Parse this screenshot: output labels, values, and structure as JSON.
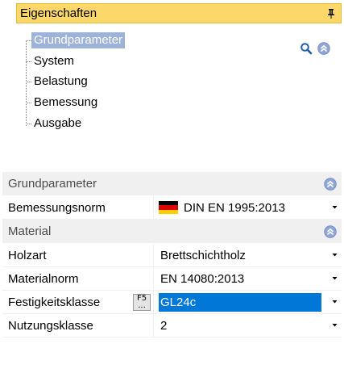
{
  "panel": {
    "title": "Eigenschaften",
    "pin_icon": "pin-icon"
  },
  "tree": {
    "items": [
      {
        "label": "Grundparameter",
        "selected": true
      },
      {
        "label": "System",
        "selected": false
      },
      {
        "label": "Belastung",
        "selected": false
      },
      {
        "label": "Bemessung",
        "selected": false
      },
      {
        "label": "Ausgabe",
        "selected": false
      }
    ],
    "tools": [
      "search-icon",
      "collapse-all-icon"
    ]
  },
  "grid": {
    "grundparameter": {
      "title": "Grundparameter",
      "bemessungsnorm": {
        "name": "Bemessungsnorm",
        "value": "DIN EN 1995:2013",
        "flag": "germany-flag-icon"
      }
    },
    "material": {
      "title": "Material",
      "holzart": {
        "name": "Holzart",
        "value": "Brettschichtholz"
      },
      "materialnorm": {
        "name": "Materialnorm",
        "value": "EN 14080:2013"
      },
      "festigkeitsklasse": {
        "name": "Festigkeitsklasse",
        "value": "GL24c",
        "hotkey_top": "F5",
        "hotkey_bottom": "..."
      },
      "nutzungsklasse": {
        "name": "Nutzungsklasse",
        "value": "2"
      }
    }
  },
  "colors": {
    "titlebar": "#fcd86a",
    "tree_selection": "#9db3da",
    "value_selection": "#0078d7",
    "category_bg": "#f0f0f0",
    "expand_icon": "#8fa6d6"
  }
}
